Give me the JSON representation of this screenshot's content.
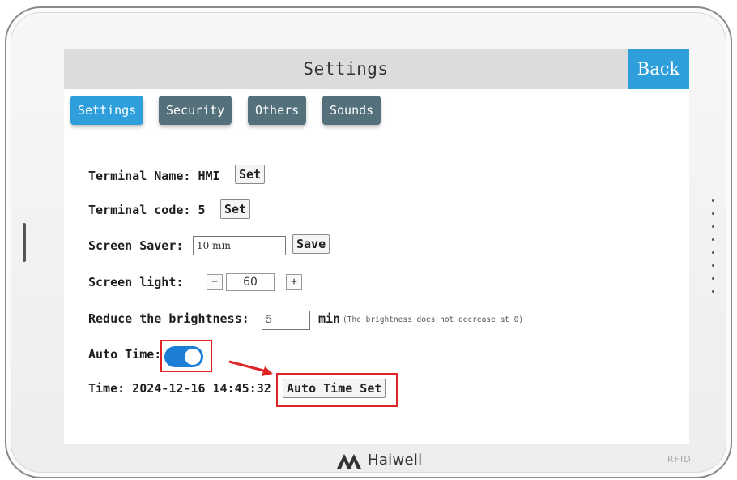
{
  "screen": {
    "title": "Settings",
    "back_label": "Back",
    "tabs": [
      {
        "label": "Settings",
        "active": true
      },
      {
        "label": "Security",
        "active": false
      },
      {
        "label": "Others",
        "active": false
      },
      {
        "label": "Sounds",
        "active": false
      }
    ]
  },
  "form": {
    "terminal_name": {
      "label": "Terminal Name: HMI",
      "button": "Set"
    },
    "terminal_code": {
      "label": "Terminal code: 5",
      "button": "Set"
    },
    "screen_saver": {
      "label": "Screen Saver:",
      "value": "10 min",
      "button": "Save"
    },
    "screen_light": {
      "label": "Screen light:",
      "minus": "−",
      "value": "60",
      "plus": "+"
    },
    "reduce_brightness": {
      "label": "Reduce the brightness:",
      "value": "5",
      "unit": "min",
      "note": "(The brightness does not decrease at 0)"
    },
    "auto_time": {
      "label": "Auto Time:",
      "enabled": true
    },
    "time": {
      "label": "Time: 2024-12-16 14:45:32",
      "button": "Auto Time Set"
    }
  },
  "device": {
    "brand": "Haiwell",
    "rfid": "RFID"
  },
  "colors": {
    "accent": "#2f9fdc",
    "tab_inactive": "#54707a",
    "toggle_on": "#1d7ed6",
    "highlight": "#e02424"
  }
}
